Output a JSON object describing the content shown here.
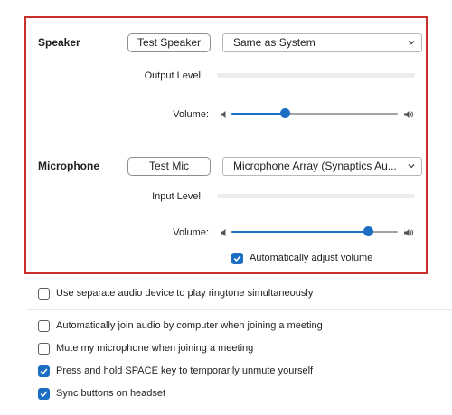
{
  "speaker": {
    "label": "Speaker",
    "test_button": "Test Speaker",
    "device": "Same as System",
    "output_level_label": "Output Level:",
    "output_level": 0,
    "volume_label": "Volume:",
    "volume": 0.32
  },
  "microphone": {
    "label": "Microphone",
    "test_button": "Test Mic",
    "device": "Microphone Array (Synaptics Au...",
    "input_level_label": "Input Level:",
    "input_level": 0,
    "volume_label": "Volume:",
    "volume": 0.82,
    "auto_adjust_label": "Automatically adjust volume",
    "auto_adjust_checked": true
  },
  "options": [
    {
      "label": "Use separate audio device to play ringtone simultaneously",
      "checked": false
    },
    {
      "label": "Automatically join audio by computer when joining a meeting",
      "checked": false
    },
    {
      "label": "Mute my microphone when joining a meeting",
      "checked": false
    },
    {
      "label": "Press and hold SPACE key to temporarily unmute yourself",
      "checked": true
    },
    {
      "label": "Sync buttons on headset",
      "checked": true
    }
  ],
  "colors": {
    "accent": "#1c6ec2",
    "highlight_border": "#c9302c"
  }
}
